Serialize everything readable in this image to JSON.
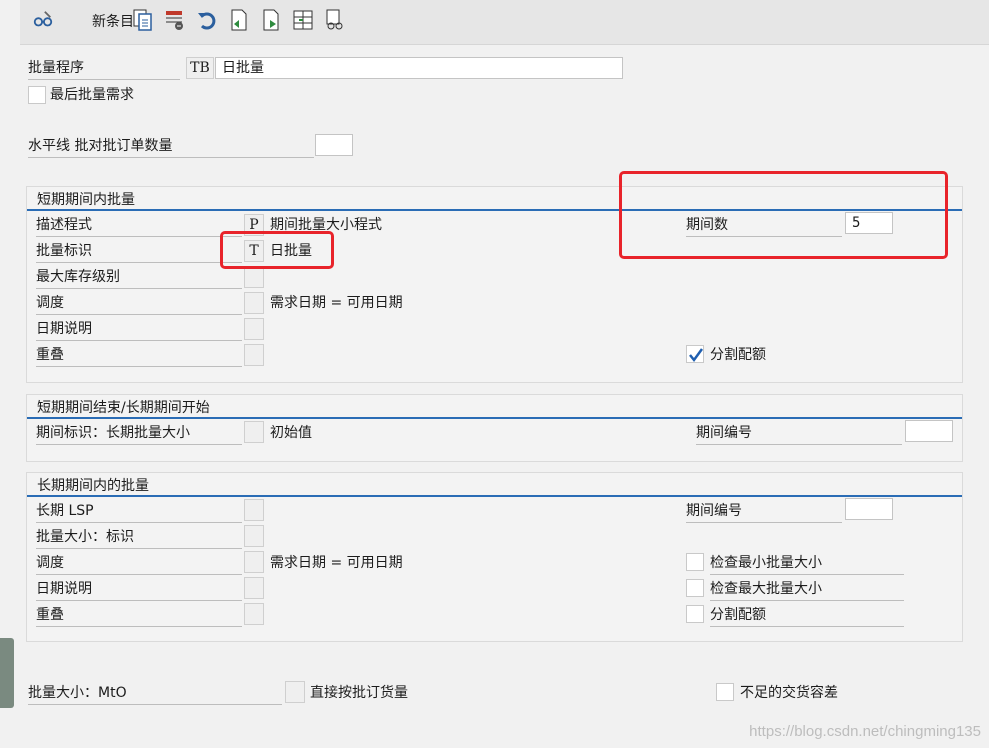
{
  "toolbar": {
    "new_entries_label": "新条目",
    "icons": [
      "glasses-pencil-icon",
      "copy-icon",
      "delete-icon",
      "undo-icon",
      "previous-entry-icon",
      "next-entry-icon",
      "select-block-icon",
      "other-object-icon"
    ]
  },
  "header": {
    "lot_procedure_label": "批量程序",
    "lot_procedure_code": "TB",
    "lot_procedure_value": "日批量",
    "last_lot_req_label": "最后批量需求",
    "horizon_label": "水平线 批对批订单数量",
    "horizon_value": ""
  },
  "short_term": {
    "title": "短期期间内批量",
    "desc_program_label": "描述程式",
    "desc_program_code": "P",
    "desc_program_value": "期间批量大小程式",
    "lot_indicator_label": "批量标识",
    "lot_indicator_code": "T",
    "lot_indicator_value": "日批量",
    "max_stock_label": "最大库存级别",
    "scheduling_label": "调度",
    "scheduling_value": "需求日期 = 可用日期",
    "date_spec_label": "日期说明",
    "overlap_label": "重叠",
    "num_periods_label": "期间数",
    "num_periods_value": "5",
    "split_quota_label": "分割配额",
    "split_quota_checked": true
  },
  "transition": {
    "title": "短期期间结束/长期期间开始",
    "period_indicator_label": "期间标识：长期批量大小",
    "initial_value_label": "初始值",
    "period_number_label": "期间编号"
  },
  "long_term": {
    "title": "长期期间内的批量",
    "lsp_label": "长期 LSP",
    "lot_size_indicator_label": "批量大小：标识",
    "scheduling_label": "调度",
    "scheduling_value": "需求日期 = 可用日期",
    "date_spec_label": "日期说明",
    "overlap_label": "重叠",
    "period_number_label": "期间编号",
    "check_min_label": "检查最小批量大小",
    "check_max_label": "检查最大批量大小",
    "split_quota_label": "分割配额"
  },
  "footer": {
    "lot_size_mto_label": "批量大小：MtO",
    "direct_procurement_label": "直接按批订货量",
    "under_delivery_label": "不足的交货容差"
  },
  "watermark": "https://blog.csdn.net/chingming135",
  "colors": {
    "accent_line": "#2a6cb5",
    "annotation_red": "#e8232a",
    "checkmark_blue": "#1f5fb0"
  }
}
